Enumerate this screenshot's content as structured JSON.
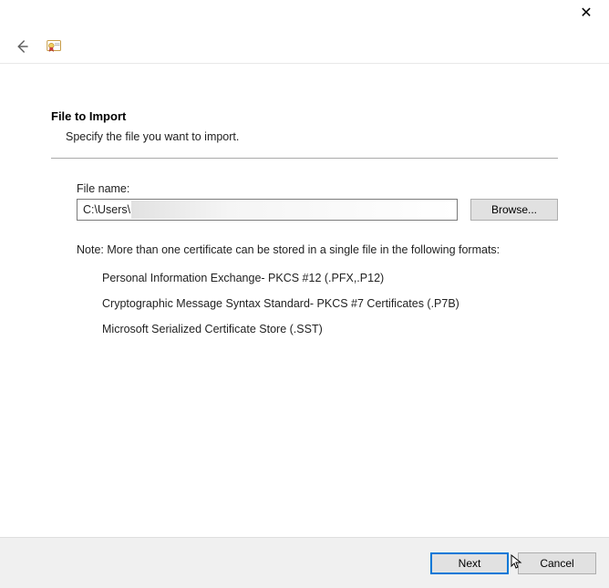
{
  "titlebar": {
    "close_glyph": "✕"
  },
  "header": {
    "title": "File to Import",
    "subtitle": "Specify the file you want to import."
  },
  "file": {
    "label": "File name:",
    "value": "C:\\Users\\",
    "browse_label": "Browse..."
  },
  "note": {
    "intro": "Note:  More than one certificate can be stored in a single file in the following formats:",
    "formats": [
      "Personal Information Exchange- PKCS #12 (.PFX,.P12)",
      "Cryptographic Message Syntax Standard- PKCS #7 Certificates (.P7B)",
      "Microsoft Serialized Certificate Store (.SST)"
    ]
  },
  "footer": {
    "next_label": "Next",
    "cancel_label": "Cancel"
  }
}
